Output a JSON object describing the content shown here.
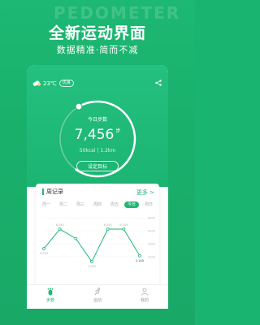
{
  "banner": {
    "watermark": "PEDOMETER",
    "headline": "全新运动界面",
    "subline": "数据精准·简而不减"
  },
  "status": {
    "weather_icon": "cloud-icon",
    "temperature": "23℃",
    "aqi": "优良"
  },
  "today": {
    "label": "今日步数",
    "steps": "7,456",
    "steps_unit": "步",
    "stats": "50kcal  |  1.2km",
    "goal_button": "设定目标",
    "progress": 0.68
  },
  "week": {
    "title": "周记录",
    "more": "更多 >",
    "days": [
      "周一",
      "周二",
      "周三",
      "周四",
      "周五",
      "今日",
      "周日"
    ],
    "active_day": 5,
    "labels": [
      "3,245",
      "6,245",
      "",
      "1,245",
      "6,245",
      "6,245",
      "2,145"
    ],
    "scale": [
      "8000",
      "6000",
      "4000",
      "2000"
    ]
  },
  "chart_data": {
    "type": "line",
    "categories": [
      "周一",
      "周二",
      "周三",
      "周四",
      "周五",
      "今日"
    ],
    "values": [
      3245,
      6245,
      4800,
      1245,
      6245,
      6245,
      2145
    ],
    "ylim": [
      0,
      8000
    ]
  },
  "tabs": [
    {
      "label": "步数",
      "icon": "footprint-icon"
    },
    {
      "label": "运动",
      "icon": "run-icon"
    },
    {
      "label": "我的",
      "icon": "user-icon"
    }
  ],
  "colors": {
    "accent": "#1fb774",
    "bg": "#19b46f"
  }
}
